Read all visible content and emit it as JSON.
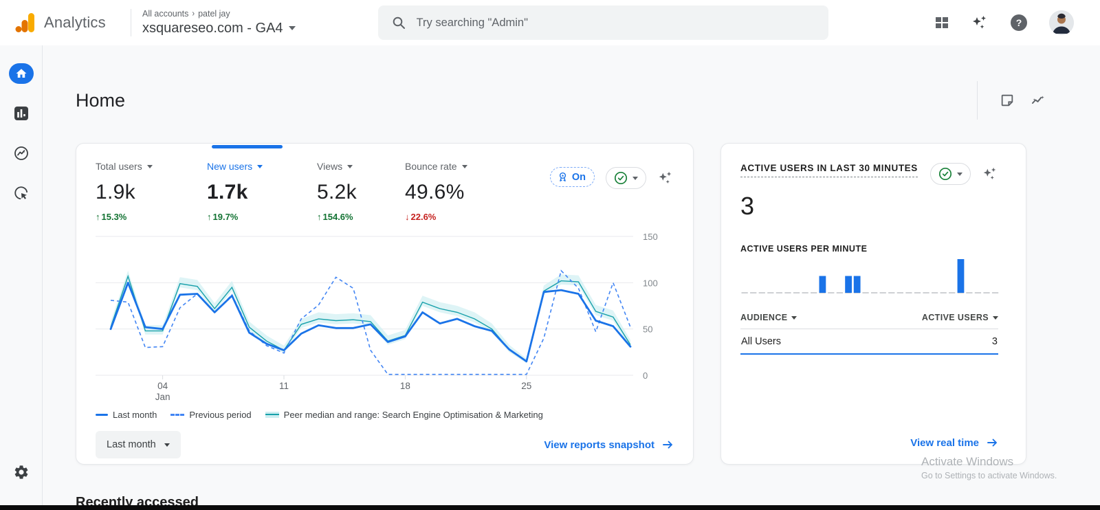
{
  "header": {
    "app_name": "Analytics",
    "breadcrumb_root": "All accounts",
    "breadcrumb_separator": "›",
    "breadcrumb_account": "patel jay",
    "property": "xsquareseo.com - GA4",
    "search_placeholder": "Try searching \"Admin\""
  },
  "page": {
    "title": "Home",
    "recently_accessed": "Recently accessed"
  },
  "overview": {
    "metrics": [
      {
        "label": "Total users",
        "value": "1.9k",
        "arrow": "↑",
        "delta": "15.3%",
        "direction": "up"
      },
      {
        "label": "New users",
        "value": "1.7k",
        "arrow": "↑",
        "delta": "19.7%",
        "direction": "up"
      },
      {
        "label": "Views",
        "value": "5.2k",
        "arrow": "↑",
        "delta": "154.6%",
        "direction": "up"
      },
      {
        "label": "Bounce rate",
        "value": "49.6%",
        "arrow": "↓",
        "delta": "22.6%",
        "direction": "down"
      }
    ],
    "benchmarking_badge_label": "On",
    "range_button_label": "Last month",
    "snapshot_link_label": "View reports snapshot"
  },
  "realtime": {
    "title": "ACTIVE USERS IN LAST 30 MINUTES",
    "value": "3",
    "per_minute_label": "ACTIVE USERS PER MINUTE",
    "table": {
      "col_audience": "AUDIENCE",
      "col_active_users": "ACTIVE USERS",
      "rows": [
        {
          "audience": "All Users",
          "active_users": "3"
        }
      ]
    },
    "realtime_link_label": "View real time"
  },
  "watermark": {
    "line1": "Activate Windows",
    "line2": "Go to Settings to activate Windows."
  },
  "colors": {
    "accent_blue": "#1a73e8",
    "previous_period_blue": "#4285f4",
    "peer_teal": "#17a0aa",
    "peer_band": "#cdeef1",
    "delta_up_green": "#137333",
    "delta_down_red": "#c5221f",
    "grid_gray": "#e8eaed"
  },
  "chart_data": [
    {
      "type": "line",
      "title": "Users over time (Last month vs Previous period vs Peer median)",
      "x_unit": "day of January",
      "categories": [
        1,
        2,
        3,
        4,
        5,
        6,
        7,
        8,
        9,
        10,
        11,
        12,
        13,
        14,
        15,
        16,
        17,
        18,
        19,
        20,
        21,
        22,
        23,
        24,
        25,
        26,
        27,
        28,
        29,
        30,
        31
      ],
      "x_ticks": [
        {
          "day": 4,
          "label": "04",
          "sublabel": "Jan"
        },
        {
          "day": 11,
          "label": "11",
          "sublabel": ""
        },
        {
          "day": 18,
          "label": "18",
          "sublabel": ""
        },
        {
          "day": 25,
          "label": "25",
          "sublabel": ""
        }
      ],
      "ylim": [
        0,
        150
      ],
      "y_ticks": [
        0,
        50,
        100,
        150
      ],
      "grid": true,
      "legend_position": "bottom",
      "series": [
        {
          "name": "Last month",
          "style": "solid",
          "color": "#1a73e8",
          "values": [
            50,
            100,
            52,
            50,
            87,
            88,
            68,
            86,
            46,
            34,
            27,
            45,
            54,
            51,
            51,
            55,
            36,
            42,
            68,
            56,
            61,
            53,
            48,
            28,
            15,
            90,
            92,
            88,
            59,
            53,
            31
          ]
        },
        {
          "name": "Previous period",
          "style": "dashed",
          "color": "#4285f4",
          "values": [
            81,
            79,
            30,
            31,
            73,
            88,
            68,
            87,
            48,
            32,
            24,
            61,
            76,
            106,
            94,
            27,
            1,
            1,
            1,
            1,
            1,
            1,
            1,
            1,
            1,
            40,
            113,
            94,
            47,
            100,
            52
          ]
        },
        {
          "name": "Peer median and range: Search Engine Optimisation & Marketing",
          "style": "line+band",
          "color": "#17a0aa",
          "band_color": "#cdeef1",
          "values": [
            52,
            107,
            48,
            48,
            99,
            96,
            72,
            95,
            52,
            37,
            27,
            55,
            61,
            59,
            60,
            58,
            37,
            43,
            79,
            72,
            68,
            61,
            50,
            28,
            15,
            91,
            102,
            101,
            69,
            63,
            33
          ],
          "band_upper": [
            58,
            113,
            54,
            54,
            106,
            103,
            78,
            102,
            58,
            43,
            32,
            61,
            68,
            66,
            67,
            65,
            43,
            49,
            86,
            79,
            75,
            68,
            56,
            33,
            18,
            97,
            109,
            108,
            76,
            70,
            38
          ],
          "band_lower": [
            48,
            103,
            44,
            44,
            95,
            92,
            68,
            91,
            48,
            33,
            24,
            51,
            57,
            55,
            56,
            54,
            33,
            39,
            75,
            68,
            64,
            57,
            46,
            25,
            13,
            87,
            98,
            97,
            65,
            59,
            29
          ]
        }
      ]
    },
    {
      "type": "bar",
      "title": "ACTIVE USERS PER MINUTE",
      "categories_note": "last 30 minutes, oldest to newest",
      "values": [
        0,
        0,
        0,
        0,
        0,
        0,
        0,
        0,
        0,
        1,
        0,
        0,
        1,
        1,
        0,
        0,
        0,
        0,
        0,
        0,
        0,
        0,
        0,
        0,
        0,
        2,
        0,
        0,
        0,
        0
      ],
      "ylim": [
        0,
        2
      ],
      "bar_color": "#1a73e8"
    }
  ]
}
